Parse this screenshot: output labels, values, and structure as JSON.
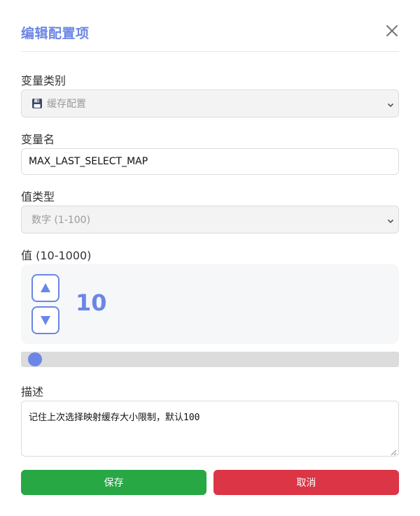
{
  "dialog": {
    "title": "编辑配置项",
    "close_icon": "close-icon"
  },
  "category": {
    "label": "变量类别",
    "icon": "floppy-disk-icon",
    "value": "缓存配置"
  },
  "var_name": {
    "label": "变量名",
    "value": "MAX_LAST_SELECT_MAP"
  },
  "value_type": {
    "label": "值类型",
    "value": "数字 (1-100)"
  },
  "value": {
    "label": "值 (10-1000)",
    "current": "10",
    "min": 10,
    "max": 1000,
    "up_icon": "arrow-up-icon",
    "down_icon": "arrow-down-icon"
  },
  "description": {
    "label": "描述",
    "value": "记住上次选择映射缓存大小限制，默认100"
  },
  "buttons": {
    "save_label": "保存",
    "cancel_label": "取消"
  },
  "colors": {
    "accent": "#6b86e6",
    "save": "#28a745",
    "cancel": "#dc3545"
  }
}
